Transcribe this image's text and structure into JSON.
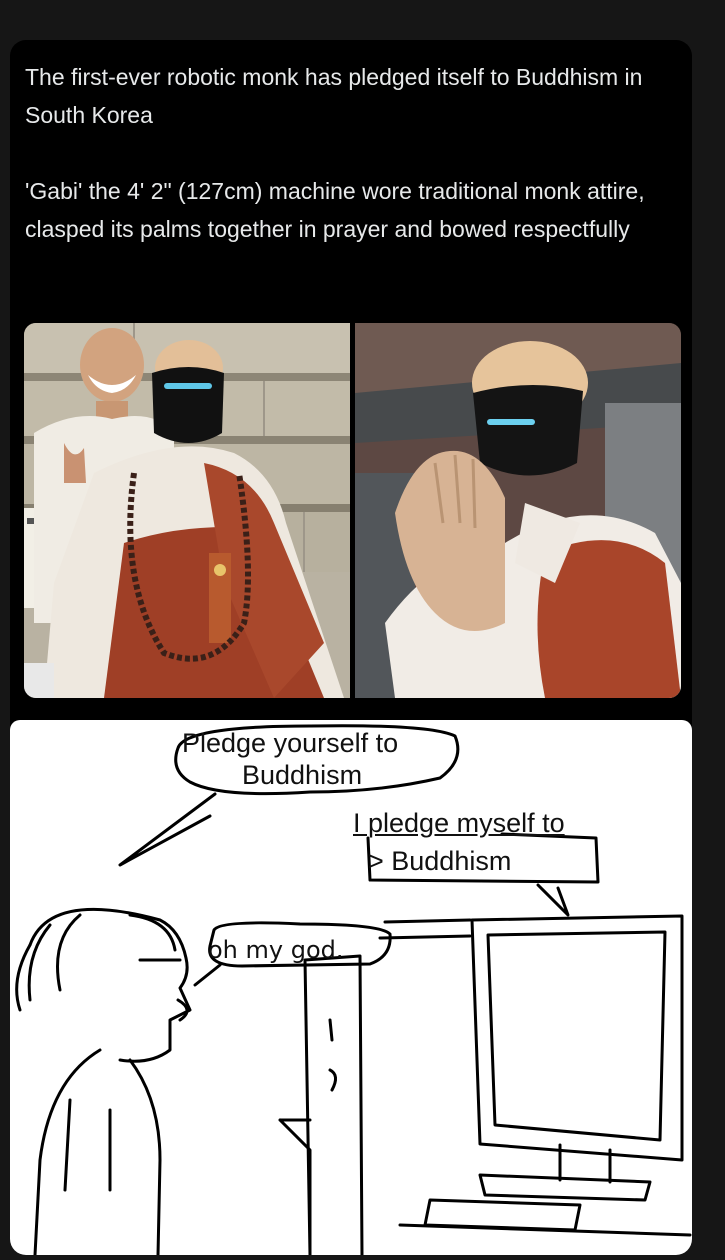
{
  "post": {
    "paragraph1": "The first-ever robotic monk has pledged itself to Buddhism in South Korea",
    "paragraph2": "'Gabi' the 4' 2\" (127cm) machine wore traditional monk attire, clasped its palms together in prayer and bowed respectfully"
  },
  "comic": {
    "speech_pledge_line1": "Pledge yourself to",
    "speech_pledge_line2": "Buddhism",
    "reply_line1": "I pledge myself to",
    "reply_line2": "> Buddhism",
    "reaction": "oh my god."
  }
}
